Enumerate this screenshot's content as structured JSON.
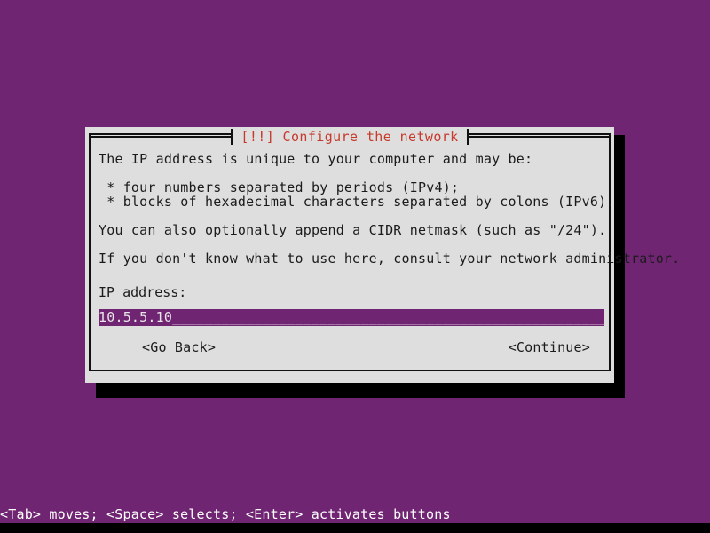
{
  "screen": {
    "background_color": "#702572",
    "bottom_strip_color": "#000000"
  },
  "dialog": {
    "title": "[!!] Configure the network",
    "title_color": "#c7392b",
    "background_color": "#dedede",
    "border_color": "#111111",
    "shadow_color": "#000000",
    "body": {
      "intro": "The IP address is unique to your computer and may be:",
      "bullets": " * four numbers separated by periods (IPv4);\n * blocks of hexadecimal characters separated by colons (IPv6).",
      "cidr_note": "You can also optionally append a CIDR netmask (such as \"/24\").",
      "help_note": "If you don't know what to use here, consult your network administrator."
    },
    "field": {
      "label": "IP address:",
      "value": "10.5.5.10",
      "cursor": "_",
      "fill": "_________________________________________________________",
      "background_color": "#702572",
      "value_color": "#e8e4e8",
      "fill_color": "#c9a9c9"
    },
    "buttons": {
      "go_back": "<Go Back>",
      "continue": "<Continue>"
    }
  },
  "status_bar": {
    "text": "<Tab> moves; <Space> selects; <Enter> activates buttons",
    "background_color": "#702572",
    "text_color": "#ffffff"
  }
}
